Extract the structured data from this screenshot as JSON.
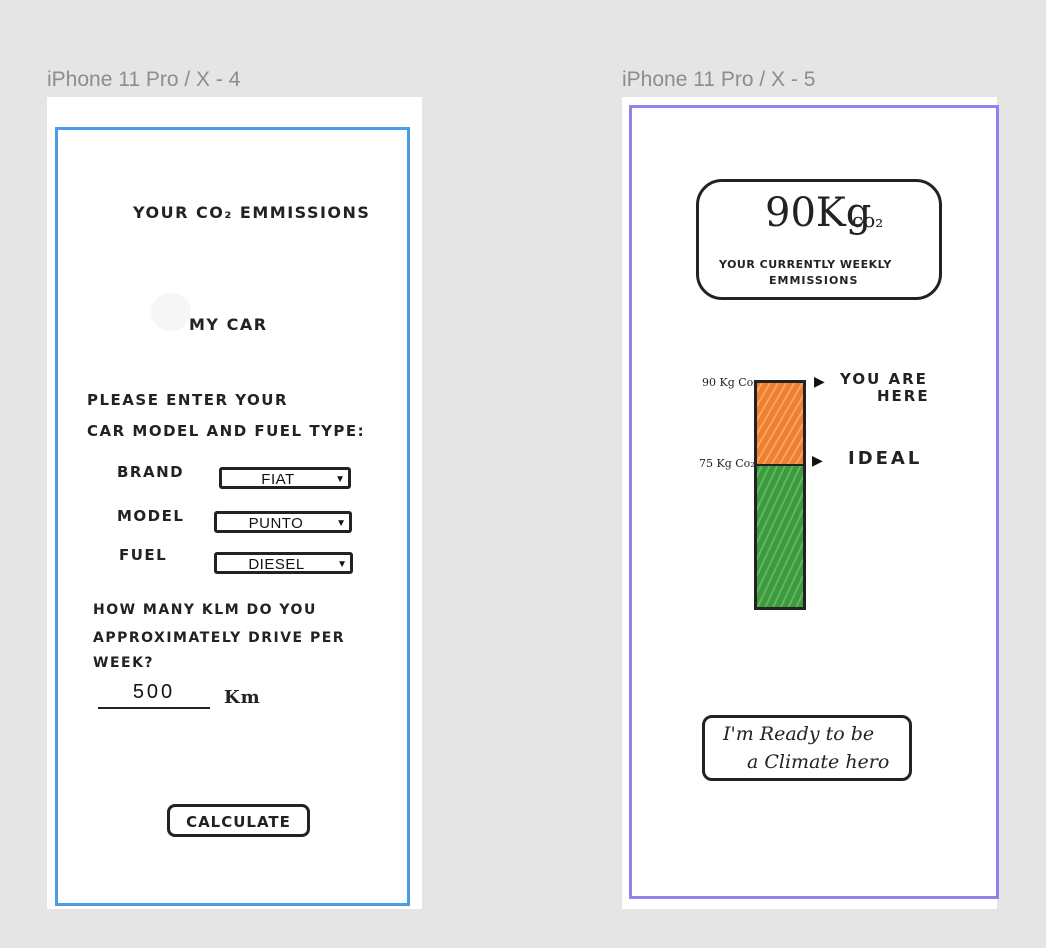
{
  "frames": [
    {
      "label": "iPhone 11 Pro / X - 4",
      "border_color": "#4a9ce8"
    },
    {
      "label": "iPhone 11 Pro / X - 5",
      "border_color": "#8f85e8"
    }
  ],
  "screen_left": {
    "title": "YOUR CO₂ EMMISSIONS",
    "subtitle": "MY CAR",
    "instruction_line1": "PLEASE ENTER YOUR",
    "instruction_line2": "CAR MODEL AND FUEL TYPE:",
    "fields": [
      {
        "label": "BRAND",
        "value": "FIAT"
      },
      {
        "label": "MODEL",
        "value": "PUNTO"
      },
      {
        "label": "FUEL",
        "value": "DIESEL"
      }
    ],
    "question_line1": "HOW MANY KLM DO YOU",
    "question_line2": "APPROXIMATELY DRIVE PER",
    "question_line3": "WEEK?",
    "km_value": "500",
    "km_unit": "Km",
    "calculate_label": "CALCULATE"
  },
  "screen_right": {
    "emission_value": "90Kg",
    "emission_unit": "co₂",
    "emission_caption_line1": "YOUR CURRENTLY WEEKLY",
    "emission_caption_line2": "EMMISSIONS",
    "gauge_top_label": "90 Kg Co₂",
    "gauge_mid_label": "75 Kg Co₂",
    "you_are_line1": "YOU ARE",
    "you_are_line2": "HERE",
    "ideal_label": "IDEAL",
    "gauge_current_kg": 90,
    "gauge_ideal_kg": 75,
    "over_color": "#f07f2e",
    "ideal_color": "#3f9a3f",
    "hero_line1": "I'm Ready to be",
    "hero_line2": "a Climate hero"
  }
}
